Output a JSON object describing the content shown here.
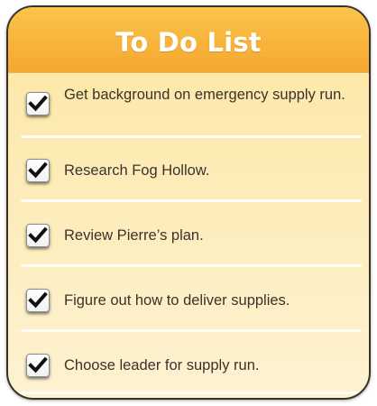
{
  "header": {
    "title": "To Do List"
  },
  "items": [
    {
      "label": "Get background on emergency supply run.",
      "checked": true
    },
    {
      "label": "Research Fog Hollow.",
      "checked": true
    },
    {
      "label": "Review Pierre’s plan.",
      "checked": true
    },
    {
      "label": "Figure out how to deliver supplies.",
      "checked": true
    },
    {
      "label": "Choose leader for supply run.",
      "checked": true
    }
  ],
  "colors": {
    "header": "#f8b43a",
    "panel": "#fdecb8",
    "text": "#3a332b",
    "title": "#ffffff"
  },
  "icons": {
    "check": "check-icon"
  }
}
